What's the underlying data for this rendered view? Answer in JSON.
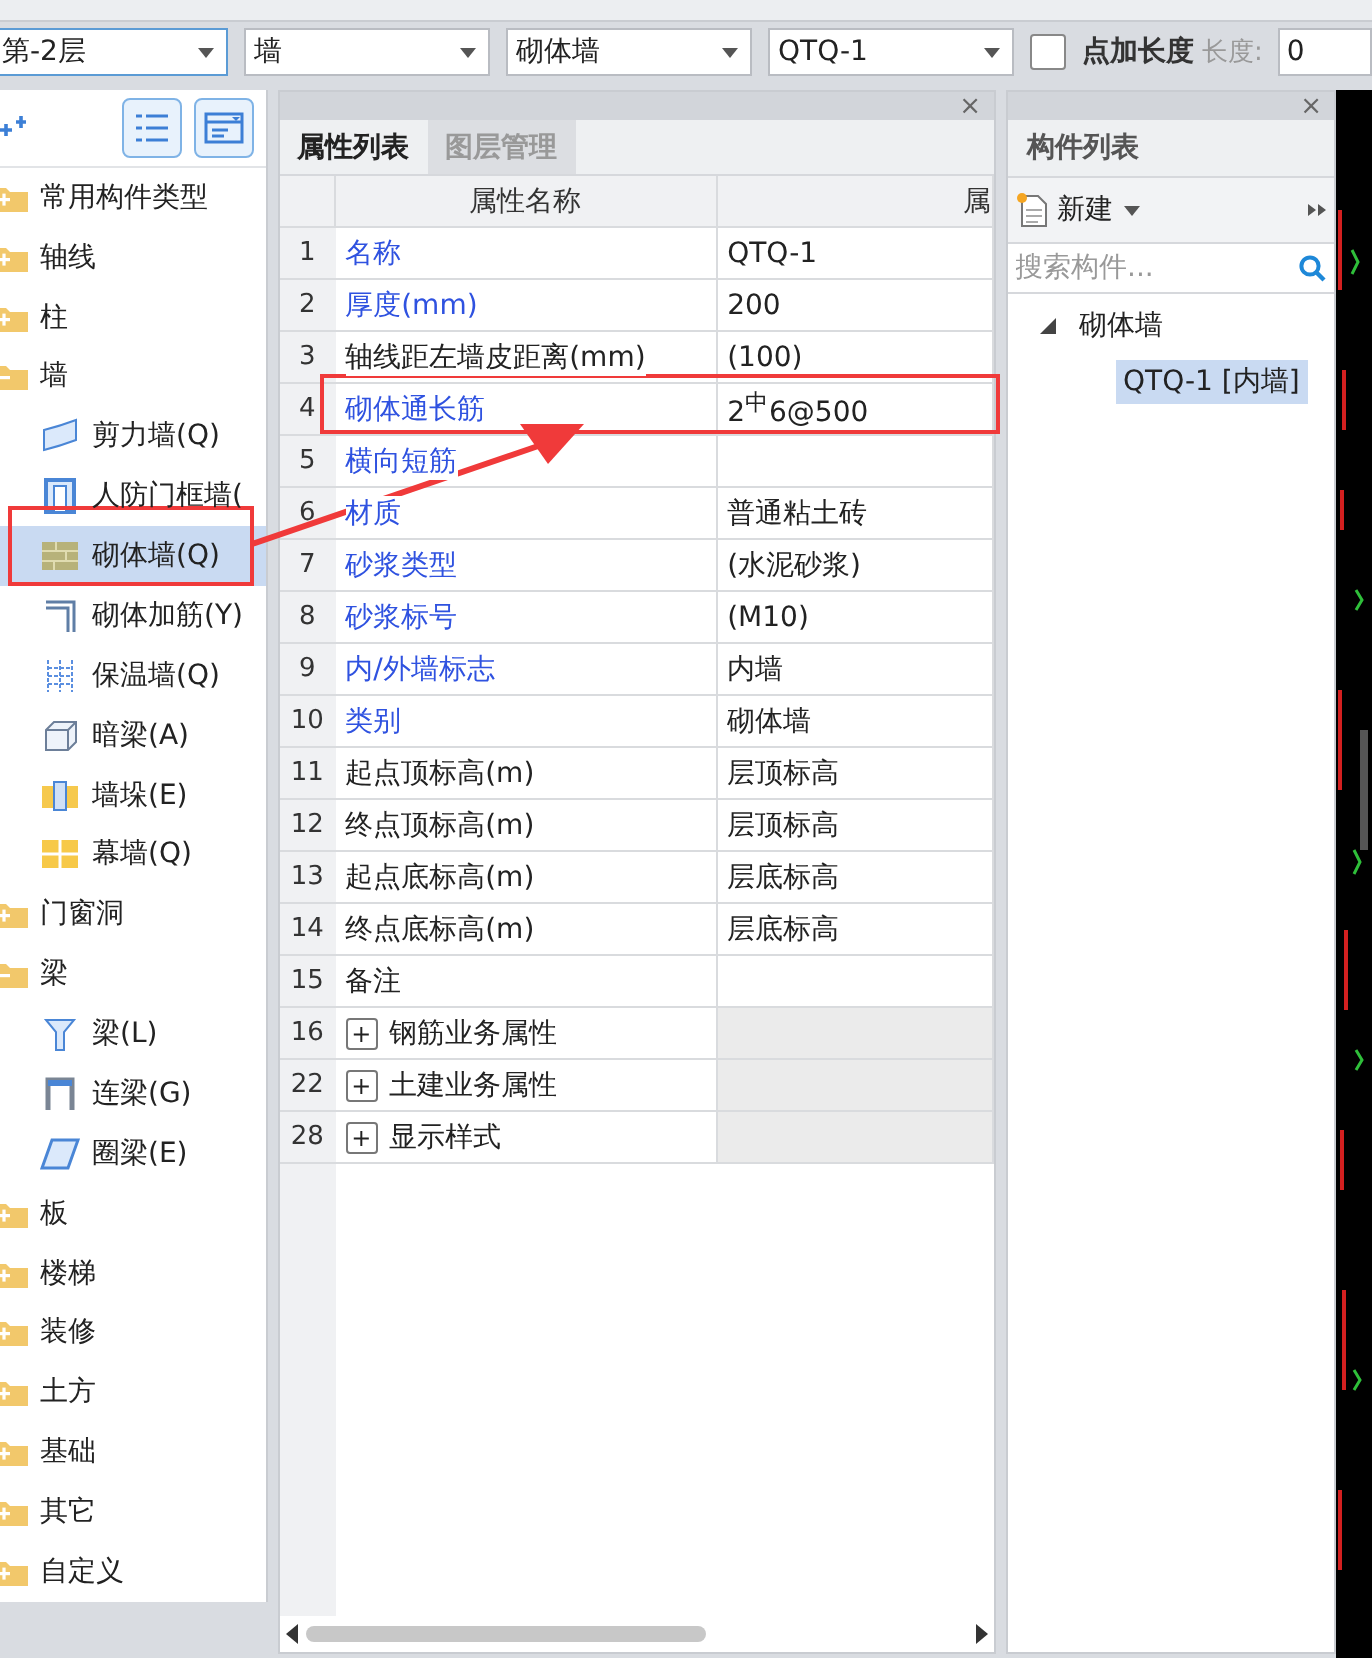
{
  "toolbar": {
    "combos": [
      {
        "value": "第-2层",
        "focused": true
      },
      {
        "value": "墙",
        "focused": false
      },
      {
        "value": "砌体墙",
        "focused": false
      },
      {
        "value": "QTQ-1",
        "focused": false
      }
    ],
    "add_length": {
      "label": "点加长度",
      "checked": false
    },
    "length": {
      "label": "长度:",
      "value": "0",
      "disabled": true
    }
  },
  "sidebar": {
    "items": [
      {
        "label": "常用构件类型",
        "expanded": false
      },
      {
        "label": "轴线",
        "expanded": false
      },
      {
        "label": "柱",
        "expanded": false
      },
      {
        "label": "墙",
        "expanded": true,
        "children": [
          {
            "label": "剪力墙(Q)",
            "kind": "shear",
            "selected": false
          },
          {
            "label": "人防门框墙(",
            "kind": "frame",
            "selected": false
          },
          {
            "label": "砌体墙(Q)",
            "kind": "masonry",
            "selected": true
          },
          {
            "label": "砌体加筋(Y)",
            "kind": "rebar",
            "selected": false
          },
          {
            "label": "保温墙(Q)",
            "kind": "insulation",
            "selected": false
          },
          {
            "label": "暗梁(A)",
            "kind": "hidden_beam",
            "selected": false
          },
          {
            "label": "墙垛(E)",
            "kind": "pier",
            "selected": false
          },
          {
            "label": "幕墙(Q)",
            "kind": "curtain",
            "selected": false
          }
        ]
      },
      {
        "label": "门窗洞",
        "expanded": false
      },
      {
        "label": "梁",
        "expanded": true,
        "children": [
          {
            "label": "梁(L)",
            "kind": "beam",
            "selected": false
          },
          {
            "label": "连梁(G)",
            "kind": "link_beam",
            "selected": false
          },
          {
            "label": "圈梁(E)",
            "kind": "ring_beam",
            "selected": false
          }
        ]
      },
      {
        "label": "板",
        "expanded": false
      },
      {
        "label": "楼梯",
        "expanded": false
      },
      {
        "label": "装修",
        "expanded": false
      },
      {
        "label": "土方",
        "expanded": false
      },
      {
        "label": "基础",
        "expanded": false
      },
      {
        "label": "其它",
        "expanded": false
      },
      {
        "label": "自定义",
        "expanded": false
      }
    ]
  },
  "properties": {
    "close": "×",
    "tabs": [
      {
        "label": "属性列表",
        "selected": true
      },
      {
        "label": "图层管理",
        "selected": false
      }
    ],
    "columns": [
      "属性名称",
      "属"
    ],
    "rows": [
      {
        "number": "1",
        "name": "名称",
        "value": "QTQ-1",
        "kind": "public"
      },
      {
        "number": "2",
        "name": "厚度(mm)",
        "value": "200",
        "kind": "public"
      },
      {
        "number": "3",
        "name": "轴线距左墙皮距离(mm)",
        "value": "(100)",
        "kind": "private"
      },
      {
        "number": "4",
        "name": "砌体通长筋",
        "value": "2$^{中}$6@500",
        "kind": "public"
      },
      {
        "number": "5",
        "name": "横向短筋",
        "value": "",
        "kind": "public"
      },
      {
        "number": "6",
        "name": "材质",
        "value": "普通粘土砖",
        "kind": "public"
      },
      {
        "number": "7",
        "name": "砂浆类型",
        "value": "(水泥砂浆)",
        "kind": "public"
      },
      {
        "number": "8",
        "name": "砂浆标号",
        "value": "(M10)",
        "kind": "public"
      },
      {
        "number": "9",
        "name": "内/外墙标志",
        "value": "内墙",
        "kind": "public"
      },
      {
        "number": "10",
        "name": "类别",
        "value": "砌体墙",
        "kind": "public"
      },
      {
        "number": "11",
        "name": "起点顶标高(m)",
        "value": "层顶标高",
        "kind": "private"
      },
      {
        "number": "12",
        "name": "终点顶标高(m)",
        "value": "层顶标高",
        "kind": "private"
      },
      {
        "number": "13",
        "name": "起点底标高(m)",
        "value": "层底标高",
        "kind": "private"
      },
      {
        "number": "14",
        "name": "终点底标高(m)",
        "value": "层底标高",
        "kind": "private"
      },
      {
        "number": "15",
        "name": "备注",
        "value": "",
        "kind": "private"
      },
      {
        "number": "16",
        "name": "钢筋业务属性",
        "kind": "group",
        "expanded": false,
        "toggle": "+"
      },
      {
        "number": "22",
        "name": "土建业务属性",
        "kind": "group",
        "expanded": false,
        "toggle": "+"
      },
      {
        "number": "28",
        "name": "显示样式",
        "kind": "group",
        "expanded": false,
        "toggle": "+"
      }
    ]
  },
  "components": {
    "close": "×",
    "title": "构件列表",
    "new_button": "新建",
    "search": {
      "placeholder": "搜索构件..."
    },
    "tree": [
      {
        "label": "砌体墙",
        "expanded": true,
        "children": [
          {
            "label": "QTQ-1 [内墙]",
            "selected": true
          }
        ]
      }
    ]
  }
}
